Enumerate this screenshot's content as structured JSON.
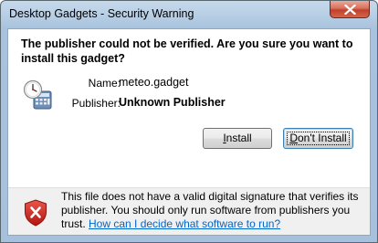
{
  "window": {
    "title": "Desktop Gadgets - Security Warning"
  },
  "dialog": {
    "headline": "The publisher could not be verified. Are you sure you want to install this gadget?",
    "name_label": "Name:",
    "name_value": "meteo.gadget",
    "publisher_label": "Publisher:",
    "publisher_value": "Unknown Publisher",
    "install_prefix": "",
    "install_mnemonic": "I",
    "install_rest": "nstall",
    "dont_install_prefix": "",
    "dont_install_mnemonic": "D",
    "dont_install_rest": "on't Install"
  },
  "warning": {
    "text": "This file does not have a valid digital signature that verifies its publisher. You should only run software from publishers you trust.",
    "link": "How can I decide what software to run?"
  },
  "icons": {
    "close": "close-icon",
    "gadget": "gadget-clock-calculator-icon",
    "shield": "shield-error-icon"
  },
  "colors": {
    "link": "#0066cc",
    "close_button": "#c0412a",
    "shield": "#c8221b",
    "warning_bg": "#f0f0f0"
  }
}
